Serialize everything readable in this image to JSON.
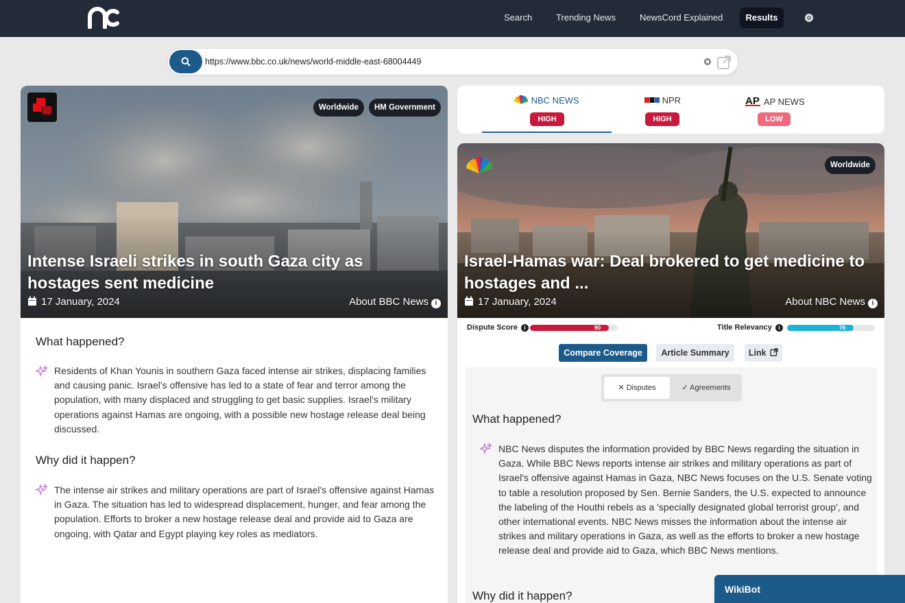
{
  "nav": {
    "logo_text": "nc",
    "links": [
      "Search",
      "Trending News",
      "NewsCord Explained"
    ],
    "active": "Results"
  },
  "search": {
    "value": "https://www.bbc.co.uk/news/world-middle-east-68004449"
  },
  "left": {
    "chips": [
      "Worldwide",
      "HM Government"
    ],
    "title": "Intense Israeli strikes in south Gaza city as hostages sent medicine",
    "date": "17 January, 2024",
    "about": "About BBC News",
    "what_heading": "What happened?",
    "what_text": "Residents of Khan Younis in southern Gaza faced intense air strikes, displacing families and causing panic. Israel's offensive has led to a state of fear and terror among the population, with many displaced and struggling to get basic supplies. Israel's military operations against Hamas are ongoing, with a possible new hostage release deal being discussed.",
    "why_heading": "Why did it happen?",
    "why_text": "The intense air strikes and military operations are part of Israel's offensive against Hamas in Gaza. The situation has led to widespread displacement, hunger, and fear among the population. Efforts to broker a new hostage release deal and provide aid to Gaza are ongoing, with Qatar and Egypt playing key roles as mediators."
  },
  "sources": [
    {
      "name": "NBC NEWS",
      "rating": "HIGH",
      "color": "#c8193d"
    },
    {
      "name": "NPR",
      "rating": "HIGH",
      "color": "#c8193d"
    },
    {
      "name": "AP NEWS",
      "rating": "LOW",
      "color": "#f06a7d"
    }
  ],
  "right": {
    "chip": "Worldwide",
    "title": "Israel-Hamas war: Deal brokered to get medicine to hostages and ...",
    "date": "17 January, 2024",
    "about": "About NBC News",
    "dispute_label": "Dispute Score",
    "dispute_value": 90,
    "relevancy_label": "Title Relevancy",
    "relevancy_value": 76,
    "buttons": {
      "compare": "Compare Coverage",
      "summary": "Article Summary",
      "link": "Link"
    },
    "toggle": {
      "disputes": "Disputes",
      "agreements": "Agreements"
    },
    "what_heading": "What happened?",
    "what_text": "NBC News disputes the information provided by BBC News regarding the situation in Gaza. While BBC News reports intense air strikes and military operations as part of Israel's offensive against Hamas in Gaza, NBC News focuses on the U.S. Senate voting to table a resolution proposed by Sen. Bernie Sanders, the U.S. expected to announce the labeling of the Houthi rebels as a 'specially designated global terrorist group', and other international events. NBC News misses the information about the intense air strikes and military operations in Gaza, as well as the efforts to broker a new hostage release deal and provide aid to Gaza, which BBC News mentions.",
    "why_heading": "Why did it happen?"
  },
  "wikibot": "WikiBot",
  "colors": {
    "nav": "#232a38",
    "accent": "#1c5a8a",
    "dispute": "#c8193d",
    "relevancy": "#1eb3d6"
  }
}
